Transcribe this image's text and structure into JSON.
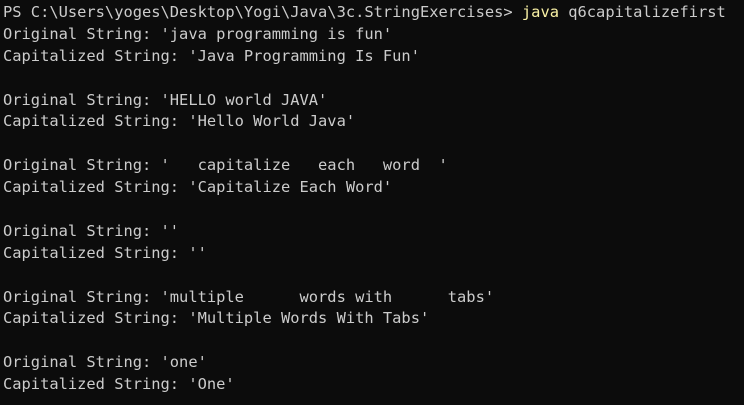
{
  "terminal": {
    "prompt": {
      "path": "PS C:\\Users\\yoges\\Desktop\\Yogi\\Java\\3c.StringExercises> ",
      "command": "java",
      "argument": " q6capitalizefirst"
    },
    "output": [
      "Original String: 'java programming is fun'",
      "Capitalized String: 'Java Programming Is Fun'",
      "",
      "Original String: 'HELLO world JAVA'",
      "Capitalized String: 'Hello World Java'",
      "",
      "Original String: '   capitalize   each   word  '",
      "Capitalized String: 'Capitalize Each Word'",
      "",
      "Original String: ''",
      "Capitalized String: ''",
      "",
      "Original String: 'multiple      words with      tabs'",
      "Capitalized String: 'Multiple Words With Tabs'",
      "",
      "Original String: 'one'",
      "Capitalized String: 'One'"
    ],
    "colors": {
      "background": "#0c0c0c",
      "text": "#cccccc",
      "command": "#f9f1a5"
    }
  }
}
